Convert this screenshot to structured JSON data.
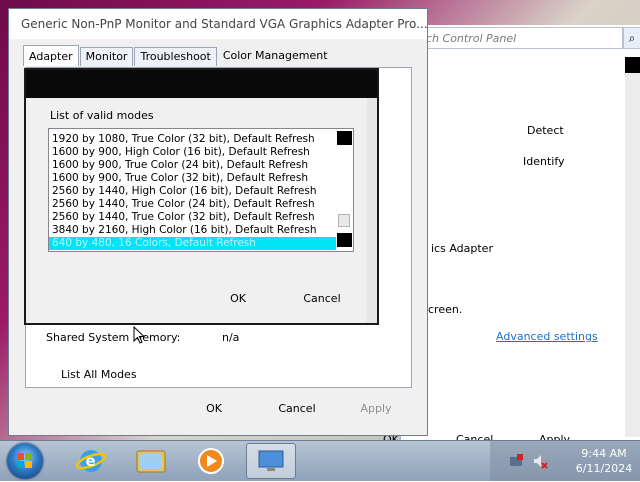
{
  "dialog": {
    "title": "Generic Non-PnP Monitor and Standard VGA Graphics Adapter Pro...",
    "tabs": [
      "Adapter",
      "Monitor",
      "Troubleshoot",
      "Color Management"
    ],
    "panel": {
      "shared_memory_label": "Shared System Memory:",
      "shared_memory_value": "n/a",
      "list_all_modes": "List All Modes"
    },
    "buttons": {
      "ok": "OK",
      "cancel": "Cancel",
      "apply": "Apply"
    }
  },
  "modes_dialog": {
    "label": "List of valid modes",
    "modes": [
      "1920 by 1080, True Color (32 bit), Default Refresh",
      "1600 by 900, High Color (16 bit), Default Refresh",
      "1600 by 900, True Color (24 bit), Default Refresh",
      "1600 by 900, True Color (32 bit), Default Refresh",
      "2560 by 1440, High Color (16 bit), Default Refresh",
      "2560 by 1440, True Color (24 bit), Default Refresh",
      "2560 by 1440, True Color (32 bit), Default Refresh",
      "3840 by 2160, High Color (16 bit), Default Refresh",
      "640 by 480, 16 Colors, Default Refresh"
    ],
    "selected_mode": "640 by 480, 16 Colors, Default Refresh",
    "buttons": {
      "ok": "OK",
      "cancel": "Cancel"
    }
  },
  "background_window": {
    "search_placeholder": "ch Control Panel",
    "detect": "Detect",
    "identify": "Identify",
    "adapter_text": "ics Adapter",
    "screen_text": "creen.",
    "advanced_settings": "Advanced settings",
    "footer_ok": "OK",
    "footer_cancel": "Cancel",
    "footer_apply": "Apply"
  },
  "taskbar": {
    "time": "9:44 AM",
    "date": "6/11/2024",
    "icons": [
      "start-orb",
      "internet-explorer-icon",
      "file-explorer-icon",
      "media-player-icon",
      "display-settings-icon"
    ]
  },
  "colors": {
    "selection": "#00e5f5",
    "link": "#1e6fd1",
    "taskbar": "#9fb1c7"
  }
}
